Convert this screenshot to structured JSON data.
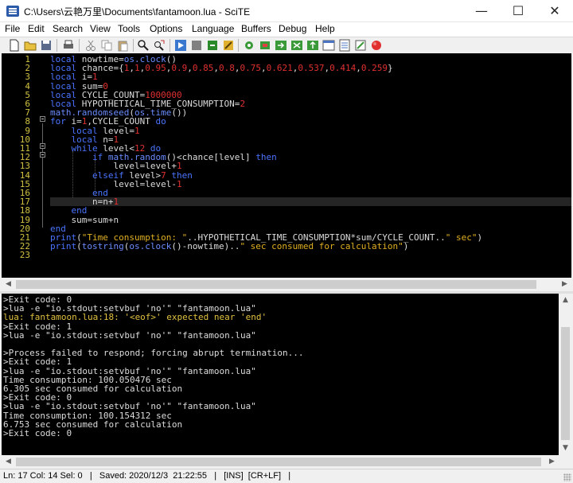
{
  "window": {
    "title": "C:\\Users\\云艳万里\\Documents\\fantamoon.lua - SciTE",
    "minimize_glyph": "—",
    "maximize_glyph": "☐",
    "close_glyph": "✕"
  },
  "menu": [
    "File",
    "Edit",
    "Search",
    "View",
    "Tools",
    "Options",
    "Language",
    "Buffers",
    "Debug",
    "Help"
  ],
  "toolbar": {
    "icons": [
      "new-icon",
      "open-icon",
      "save-icon",
      "print-icon",
      "cut-icon",
      "copy-icon",
      "paste-icon",
      "delete-icon",
      "undo-icon",
      "redo-icon",
      "find-icon",
      "replace-icon",
      "compile-icon",
      "build-icon",
      "go-icon",
      "stop-icon",
      "toggle-icon",
      "next-icon",
      "prev-icon",
      "macro-icon",
      "options-icon",
      "abbrev-icon",
      "expand-icon",
      "record-icon",
      "close-icon"
    ]
  },
  "editor": {
    "line_numbers": [
      "1",
      "2",
      "3",
      "4",
      "5",
      "6",
      "7",
      "8",
      "9",
      "10",
      "11",
      "12",
      "13",
      "14",
      "15",
      "16",
      "17",
      "18",
      "19",
      "20",
      "21",
      "22",
      "23"
    ],
    "lines": [
      [
        {
          "t": "local",
          "c": "kw"
        },
        {
          "t": " nowtime=",
          "c": "op"
        },
        {
          "t": "os.clock",
          "c": "fn"
        },
        {
          "t": "()",
          "c": "op"
        }
      ],
      [
        {
          "t": "local",
          "c": "kw"
        },
        {
          "t": " chance={",
          "c": "op"
        },
        {
          "t": "1",
          "c": "num"
        },
        {
          "t": ",",
          "c": "op"
        },
        {
          "t": "1",
          "c": "num"
        },
        {
          "t": ",",
          "c": "op"
        },
        {
          "t": "0.95",
          "c": "num"
        },
        {
          "t": ",",
          "c": "op"
        },
        {
          "t": "0.9",
          "c": "num"
        },
        {
          "t": ",",
          "c": "op"
        },
        {
          "t": "0.85",
          "c": "num"
        },
        {
          "t": ",",
          "c": "op"
        },
        {
          "t": "0.8",
          "c": "num"
        },
        {
          "t": ",",
          "c": "op"
        },
        {
          "t": "0.75",
          "c": "num"
        },
        {
          "t": ",",
          "c": "op"
        },
        {
          "t": "0.621",
          "c": "num"
        },
        {
          "t": ",",
          "c": "op"
        },
        {
          "t": "0.537",
          "c": "num"
        },
        {
          "t": ",",
          "c": "op"
        },
        {
          "t": "0.414",
          "c": "num"
        },
        {
          "t": ",",
          "c": "op"
        },
        {
          "t": "0.259",
          "c": "num"
        },
        {
          "t": "}",
          "c": "op"
        }
      ],
      [
        {
          "t": "local",
          "c": "kw"
        },
        {
          "t": " i=",
          "c": "op"
        },
        {
          "t": "1",
          "c": "num"
        }
      ],
      [
        {
          "t": "local",
          "c": "kw"
        },
        {
          "t": " sum=",
          "c": "op"
        },
        {
          "t": "0",
          "c": "num"
        }
      ],
      [
        {
          "t": "local",
          "c": "kw"
        },
        {
          "t": " CYCLE_COUNT=",
          "c": "op"
        },
        {
          "t": "1000000",
          "c": "num"
        }
      ],
      [
        {
          "t": "local",
          "c": "kw"
        },
        {
          "t": " HYPOTHETICAL_TIME_CONSUMPTION=",
          "c": "op"
        },
        {
          "t": "2",
          "c": "num"
        }
      ],
      [
        {
          "t": "math.randomseed",
          "c": "fn"
        },
        {
          "t": "(",
          "c": "op"
        },
        {
          "t": "os.time",
          "c": "fn"
        },
        {
          "t": "())",
          "c": "op"
        }
      ],
      [
        {
          "t": "for",
          "c": "kw"
        },
        {
          "t": " i=",
          "c": "op"
        },
        {
          "t": "1",
          "c": "num"
        },
        {
          "t": ",CYCLE_COUNT ",
          "c": "op"
        },
        {
          "t": "do",
          "c": "kw"
        }
      ],
      [
        {
          "t": "    ",
          "c": "op"
        },
        {
          "t": "local",
          "c": "kw"
        },
        {
          "t": " level=",
          "c": "op"
        },
        {
          "t": "1",
          "c": "num"
        }
      ],
      [
        {
          "t": "    ",
          "c": "op"
        },
        {
          "t": "local",
          "c": "kw"
        },
        {
          "t": " n=",
          "c": "op"
        },
        {
          "t": "1",
          "c": "num"
        }
      ],
      [
        {
          "t": "    ",
          "c": "op"
        },
        {
          "t": "while",
          "c": "kw"
        },
        {
          "t": " level<",
          "c": "op"
        },
        {
          "t": "12",
          "c": "num"
        },
        {
          "t": " ",
          "c": "op"
        },
        {
          "t": "do",
          "c": "kw"
        }
      ],
      [
        {
          "t": "        ",
          "c": "op"
        },
        {
          "t": "if",
          "c": "kw"
        },
        {
          "t": " ",
          "c": "op"
        },
        {
          "t": "math.random",
          "c": "fn"
        },
        {
          "t": "()<chance[level] ",
          "c": "op"
        },
        {
          "t": "then",
          "c": "kw"
        }
      ],
      [
        {
          "t": "            level=level+",
          "c": "op"
        },
        {
          "t": "1",
          "c": "num"
        }
      ],
      [
        {
          "t": "        ",
          "c": "op"
        },
        {
          "t": "elseif",
          "c": "kw"
        },
        {
          "t": " level>",
          "c": "op"
        },
        {
          "t": "7",
          "c": "num"
        },
        {
          "t": " ",
          "c": "op"
        },
        {
          "t": "then",
          "c": "kw"
        }
      ],
      [
        {
          "t": "            level=level-",
          "c": "op"
        },
        {
          "t": "1",
          "c": "num"
        }
      ],
      [
        {
          "t": "        ",
          "c": "op"
        },
        {
          "t": "end",
          "c": "kw"
        }
      ],
      [
        {
          "t": "        n=n+",
          "c": "op"
        },
        {
          "t": "1",
          "c": "num"
        }
      ],
      [
        {
          "t": "    ",
          "c": "op"
        },
        {
          "t": "end",
          "c": "kw"
        }
      ],
      [
        {
          "t": "    sum=sum+n",
          "c": "op"
        }
      ],
      [
        {
          "t": "end",
          "c": "kw"
        }
      ],
      [
        {
          "t": "print",
          "c": "kw"
        },
        {
          "t": "(",
          "c": "op"
        },
        {
          "t": "\"Time consumption: \"",
          "c": "str"
        },
        {
          "t": "..HYPOTHETICAL_TIME_CONSUMPTION*sum/CYCLE_COUNT..",
          "c": "op"
        },
        {
          "t": "\" sec\"",
          "c": "str"
        },
        {
          "t": ")",
          "c": "op"
        }
      ],
      [
        {
          "t": "print",
          "c": "kw"
        },
        {
          "t": "(",
          "c": "op"
        },
        {
          "t": "tostring",
          "c": "fn"
        },
        {
          "t": "(",
          "c": "op"
        },
        {
          "t": "os.clock",
          "c": "fn"
        },
        {
          "t": "()-nowtime)..",
          "c": "op"
        },
        {
          "t": "\" sec consumed for calculation\"",
          "c": "str"
        },
        {
          "t": ")",
          "c": "op"
        }
      ],
      []
    ],
    "current_line": 17
  },
  "output": {
    "lines": [
      {
        "t": ">Exit code: 0",
        "c": ""
      },
      {
        "t": ">lua -e \"io.stdout:setvbuf 'no'\" \"fantamoon.lua\"",
        "c": ""
      },
      {
        "t": "lua: fantamoon.lua:18: '<eof>' expected near 'end'",
        "c": "out-err"
      },
      {
        "t": ">Exit code: 1",
        "c": ""
      },
      {
        "t": ">lua -e \"io.stdout:setvbuf 'no'\" \"fantamoon.lua\"",
        "c": ""
      },
      {
        "t": "",
        "c": ""
      },
      {
        "t": ">Process failed to respond; forcing abrupt termination...",
        "c": ""
      },
      {
        "t": ">Exit code: 1",
        "c": ""
      },
      {
        "t": ">lua -e \"io.stdout:setvbuf 'no'\" \"fantamoon.lua\"",
        "c": ""
      },
      {
        "t": "Time consumption: 100.050476 sec",
        "c": ""
      },
      {
        "t": "6.305 sec consumed for calculation",
        "c": ""
      },
      {
        "t": ">Exit code: 0",
        "c": ""
      },
      {
        "t": ">lua -e \"io.stdout:setvbuf 'no'\" \"fantamoon.lua\"",
        "c": ""
      },
      {
        "t": "Time consumption: 100.154312 sec",
        "c": ""
      },
      {
        "t": "6.753 sec consumed for calculation",
        "c": ""
      },
      {
        "t": ">Exit code: 0",
        "c": ""
      }
    ]
  },
  "statusbar": {
    "text": "Ln: 17 Col: 14 Sel: 0   |   Saved: 2020/12/3  21:22:55   |   [INS]  [CR+LF]   |"
  },
  "colors": {
    "keyword": "#4a74ff",
    "number": "#e03030",
    "string": "#e0b020",
    "line_number": "#d0c040",
    "editor_bg": "#000000"
  }
}
